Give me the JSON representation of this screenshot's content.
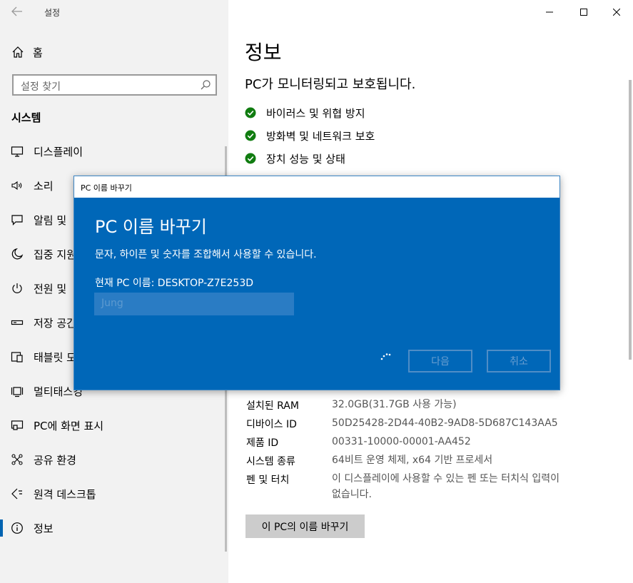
{
  "window": {
    "title": "설정",
    "minimize_glyph": "—",
    "maximize_glyph": "☐",
    "close_glyph": "✕"
  },
  "sidebar": {
    "home_label": "홈",
    "search_placeholder": "설정 찾기",
    "section_header": "시스템",
    "items": [
      {
        "label": "디스플레이",
        "icon": "display-icon"
      },
      {
        "label": "소리",
        "icon": "speaker-icon"
      },
      {
        "label": "알림 및",
        "icon": "notification-icon"
      },
      {
        "label": "집중 지원",
        "icon": "moon-icon"
      },
      {
        "label": "전원 및",
        "icon": "power-icon"
      },
      {
        "label": "저장 공간",
        "icon": "storage-icon"
      },
      {
        "label": "태블릿 모",
        "icon": "tablet-icon"
      },
      {
        "label": "멀티태스킹",
        "icon": "multitasking-icon"
      },
      {
        "label": "PC에 화면 표시",
        "icon": "project-icon"
      },
      {
        "label": "공유 환경",
        "icon": "share-icon"
      },
      {
        "label": "원격 데스크톱",
        "icon": "remote-desktop-icon"
      },
      {
        "label": "정보",
        "icon": "info-icon"
      }
    ],
    "active_index": 11
  },
  "main": {
    "page_title": "정보",
    "subtitle": "PC가 모니터링되고 보호됩니다.",
    "protection": [
      "바이러스 및 위협 방지",
      "방화벽 및 네트워크 보호",
      "장치 성능 및 상태"
    ],
    "specs": [
      {
        "label": "설치된 RAM",
        "value": "32.0GB(31.7GB 사용 가능)"
      },
      {
        "label": "디바이스 ID",
        "value": "50D25428-2D44-40B2-9AD8-5D687C143AA5"
      },
      {
        "label": "제품 ID",
        "value": "00331-10000-00001-AA452"
      },
      {
        "label": "시스템 종류",
        "value": "64비트 운영 체제, x64 기반 프로세서"
      },
      {
        "label": "펜 및 터치",
        "value": "이 디스플레이에 사용할 수 있는 펜 또는 터치식 입력이 없습니다."
      }
    ],
    "rename_button": "이 PC의 이름 바꾸기"
  },
  "dialog": {
    "window_title": "PC 이름 바꾸기",
    "heading": "PC 이름 바꾸기",
    "description": "문자, 하이픈 및 숫자를 조합해서 사용할 수 있습니다.",
    "current_name": "현재 PC 이름: DESKTOP-Z7E253D",
    "input_value": "Jung",
    "next_button": "다음",
    "cancel_button": "취소"
  },
  "colors": {
    "dialog_bg": "#0067b8",
    "accent": "#0063b1",
    "check_green": "#107c10",
    "nav_bg": "#f2f2f2"
  }
}
